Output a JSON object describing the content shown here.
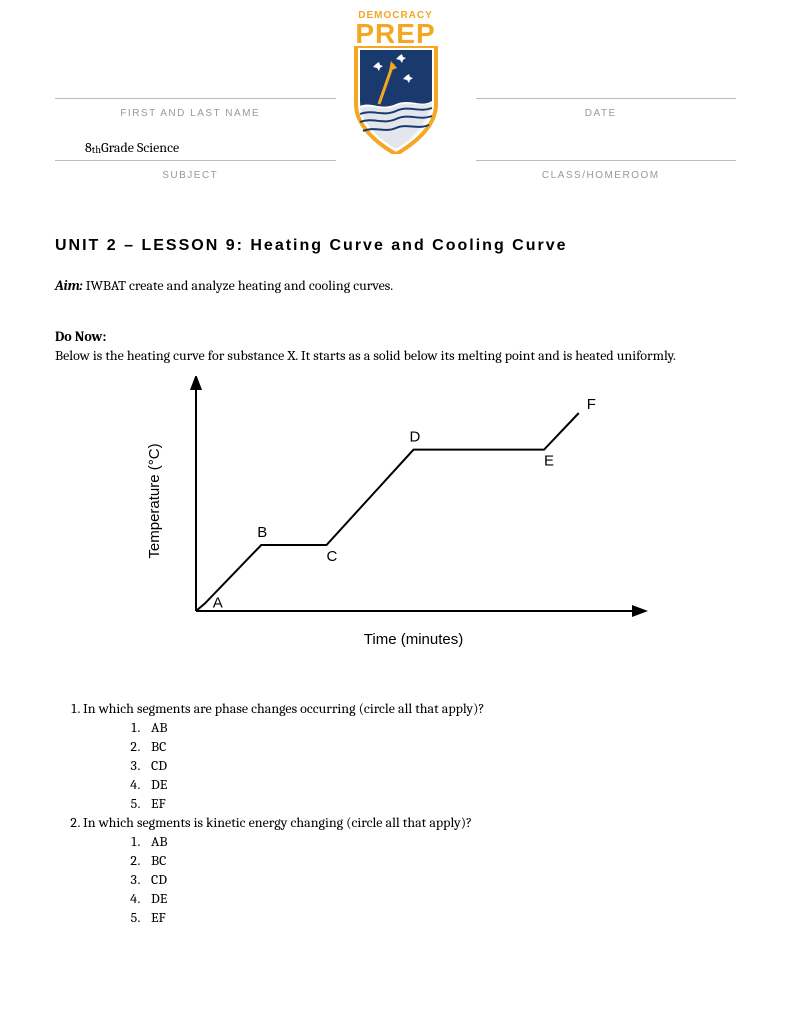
{
  "logo": {
    "line1": "DEMOCRACY",
    "line2": "PREP"
  },
  "header": {
    "name_label": "FIRST AND LAST NAME",
    "date_label": "DATE",
    "subject_label": "SUBJECT",
    "class_label": "CLASS/HOMEROOM",
    "subject_value_prefix": "8",
    "subject_value_sup": "th",
    "subject_value_suffix": " Grade Science"
  },
  "title": "UNIT 2 – LESSON 9: Heating Curve and Cooling Curve",
  "aim": {
    "label": "Aim:",
    "text": " IWBAT create and analyze heating and cooling curves."
  },
  "donow": {
    "head": "Do Now:",
    "text": "Below is the heating curve for substance X. It starts as a solid below its melting point and is heated uniformly."
  },
  "chart_data": {
    "type": "line",
    "title": "",
    "xlabel": "Time (minutes)",
    "ylabel": "Temperature (°C)",
    "annotations": [
      "A",
      "B",
      "C",
      "D",
      "E",
      "F"
    ],
    "points": [
      {
        "label": "",
        "x": 0,
        "y": 0
      },
      {
        "label": "A",
        "x": 2,
        "y": 5
      },
      {
        "label": "B",
        "x": 15,
        "y": 45
      },
      {
        "label": "C",
        "x": 30,
        "y": 45
      },
      {
        "label": "D",
        "x": 50,
        "y": 110
      },
      {
        "label": "E",
        "x": 80,
        "y": 110
      },
      {
        "label": "F",
        "x": 88,
        "y": 135
      }
    ],
    "xlim": [
      0,
      100
    ],
    "ylim": [
      0,
      150
    ]
  },
  "questions": [
    {
      "text": "In which segments are phase changes occurring (circle all that apply)?",
      "options": [
        "AB",
        "BC",
        "CD",
        "DE",
        "EF"
      ]
    },
    {
      "text": "In which segments is kinetic energy changing (circle all that apply)?",
      "options": [
        "AB",
        "BC",
        "CD",
        "DE",
        "EF"
      ]
    }
  ]
}
